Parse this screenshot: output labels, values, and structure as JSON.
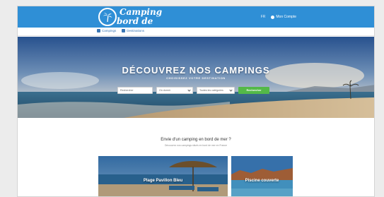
{
  "brand": {
    "line1": "Camping",
    "line2": "bord de mer"
  },
  "topbar": {
    "language": "FR",
    "account_label": "Mon Compte"
  },
  "subnav": {
    "items": [
      {
        "label": "Campings"
      },
      {
        "label": "Destinations"
      }
    ]
  },
  "hero": {
    "title": "DÉCOUVREZ NOS CAMPINGS",
    "subtitle": "CHOISISSEZ VOTRE DESTINATION",
    "search": {
      "where_placeholder": "Rechercher",
      "type_value": "Où dormir",
      "category_value": "Toutes les catégories",
      "button_label": "Rechercher"
    }
  },
  "section": {
    "title": "Envie d'un camping en bord de mer ?",
    "subtitle": "Découvrez nos campings situés en bord de mer en France"
  },
  "cards": [
    {
      "label": "Plage Pavillon Bleu"
    },
    {
      "label": "Piscine couverte"
    }
  ],
  "colors": {
    "header": "#2f8fd6",
    "search_button": "#54b948",
    "link": "#3a76b4"
  }
}
